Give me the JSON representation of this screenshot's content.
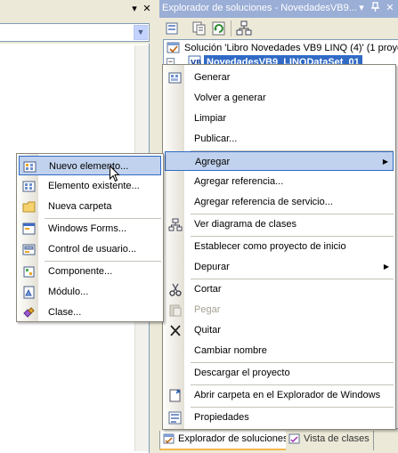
{
  "left_pane": {
    "close_glyph": "✕",
    "pin_glyph": "▾"
  },
  "solution_explorer": {
    "title": "Explorador de soluciones - NovedadesVB9...",
    "solution_node": "Solución 'Libro Novedades VB9 LINQ (4)'  (1 proyecto)",
    "selected_node": "NovedadesVB9_LINQDataSet_01"
  },
  "bottom_tabs": [
    {
      "label": "Explorador de soluciones",
      "icon": "solution-explorer-icon"
    },
    {
      "label": "Vista de clases",
      "icon": "class-view-icon"
    }
  ],
  "context_menu": {
    "items": [
      {
        "label": "Generar",
        "icon": "build-icon"
      },
      {
        "label": "Volver a generar"
      },
      {
        "label": "Limpiar"
      },
      {
        "label": "Publicar..."
      },
      {
        "label": "Agregar",
        "submenu": true
      },
      {
        "label": "Agregar referencia..."
      },
      {
        "label": "Agregar referencia de servicio..."
      },
      {
        "label": "Ver diagrama de clases",
        "icon": "class-diagram-icon"
      },
      {
        "label": "Establecer como proyecto de inicio"
      },
      {
        "label": "Depurar",
        "submenu": true
      },
      {
        "label": "Cortar",
        "icon": "cut-icon"
      },
      {
        "label": "Pegar",
        "icon": "paste-icon",
        "disabled": true
      },
      {
        "label": "Quitar",
        "icon": "delete-icon"
      },
      {
        "label": "Cambiar nombre"
      },
      {
        "label": "Descargar el proyecto"
      },
      {
        "label": "Abrir carpeta en el Explorador de Windows",
        "icon": "open-folder-icon"
      },
      {
        "label": "Propiedades",
        "icon": "properties-icon"
      }
    ]
  },
  "add_submenu": {
    "items": [
      {
        "label": "Nuevo elemento...",
        "icon": "new-item-icon"
      },
      {
        "label": "Elemento existente...",
        "icon": "existing-item-icon"
      },
      {
        "label": "Nueva carpeta",
        "icon": "new-folder-icon"
      },
      {
        "label": "Windows Forms...",
        "icon": "windows-form-icon"
      },
      {
        "label": "Control de usuario...",
        "icon": "user-control-icon"
      },
      {
        "label": "Componente...",
        "icon": "component-icon"
      },
      {
        "label": "Módulo...",
        "icon": "module-icon"
      },
      {
        "label": "Clase...",
        "icon": "class-icon"
      }
    ]
  },
  "colors": {
    "title_bar": "#9aaed6",
    "selection": "#316ac5",
    "menu_highlight": "#c1d2ee",
    "tab_accent": "#f4b74a"
  }
}
